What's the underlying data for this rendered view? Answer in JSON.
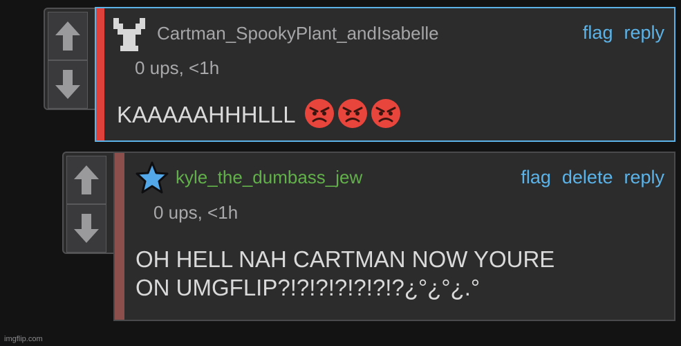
{
  "comments": [
    {
      "username": "Cartman_SpookyPlant_andIsabelle",
      "meta": "0 ups, <1h",
      "actions": [
        "flag",
        "reply"
      ],
      "text": "KAAAAAHHHLLL",
      "emoji_count": 3,
      "emoji_icon": "angry-face-emoji",
      "avatar_icon": "pixel-y-avatar-icon",
      "upvote_icon": "upvote-arrow-icon",
      "downvote_icon": "downvote-arrow-icon",
      "accent_color": "#e0413b",
      "username_color": "#a6a6a8"
    },
    {
      "username": "kyle_the_dumbass_jew",
      "meta": "0 ups, <1h",
      "actions": [
        "flag",
        "delete",
        "reply"
      ],
      "text_lines": [
        "OH HELL NAH CARTMAN NOW YOURE",
        "ON UMGFLIP?!?!?!?!?!?!?¿°¿°¿.°"
      ],
      "avatar_icon": "blue-star-avatar-icon",
      "upvote_icon": "upvote-arrow-icon",
      "downvote_icon": "downvote-arrow-icon",
      "accent_color": "#8c4f4c",
      "username_color": "#62b04a"
    }
  ],
  "colors": {
    "selected_border": "#5bb3e8",
    "link": "#5bb3e8"
  },
  "watermark": "imgflip.com"
}
